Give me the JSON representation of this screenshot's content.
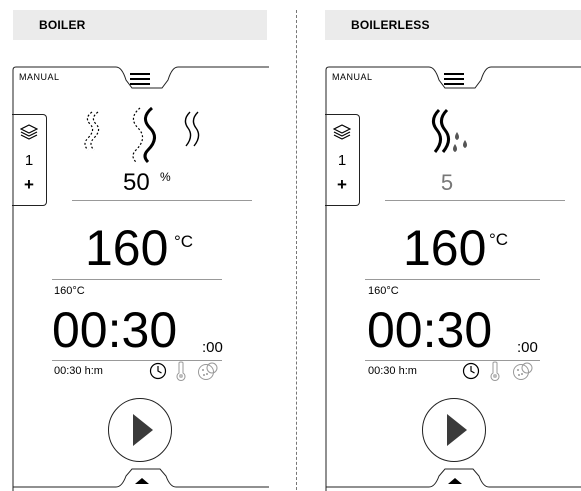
{
  "left": {
    "banner": "BOILER",
    "mode": "MANUAL",
    "layers_count": "1",
    "layers_add": "+",
    "humidity_value": "50",
    "humidity_unit": "%",
    "temp_value": "160",
    "temp_unit": "°C",
    "temp_set": "160°C",
    "time_main": "00:30",
    "time_sec": ":00",
    "time_set": "00:30 h:m"
  },
  "right": {
    "banner": "BOILERLESS",
    "mode": "MANUAL",
    "layers_count": "1",
    "layers_add": "+",
    "humidity_value": "5",
    "temp_value": "160",
    "temp_unit": "°C",
    "temp_set": "160°C",
    "time_main": "00:30",
    "time_sec": ":00",
    "time_set": "00:30 h:m"
  },
  "icons": [
    "menu-icon",
    "layers-icon",
    "steam-icon",
    "clock-icon",
    "thermometer-icon",
    "cookbook-icon",
    "play-icon",
    "chevron-up-icon"
  ]
}
